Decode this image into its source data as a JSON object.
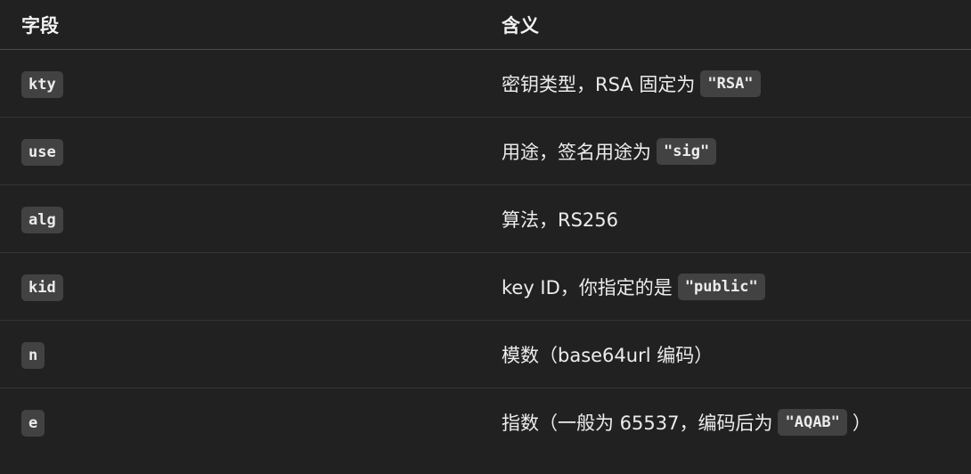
{
  "table": {
    "headers": {
      "field": "字段",
      "meaning": "含义"
    },
    "rows": [
      {
        "field": "kty",
        "text_before": "密钥类型，RSA 固定为",
        "code": "\"RSA\"",
        "text_after": ""
      },
      {
        "field": "use",
        "text_before": "用途，签名用途为",
        "code": "\"sig\"",
        "text_after": ""
      },
      {
        "field": "alg",
        "text_before": "算法，RS256",
        "code": "",
        "text_after": ""
      },
      {
        "field": "kid",
        "text_before": "key ID，你指定的是",
        "code": "\"public\"",
        "text_after": ""
      },
      {
        "field": "n",
        "text_before": "模数（base64url 编码）",
        "code": "",
        "text_after": ""
      },
      {
        "field": "e",
        "text_before": "指数（一般为 65537，编码后为",
        "code": "\"AQAB\"",
        "text_after": "）"
      }
    ]
  }
}
